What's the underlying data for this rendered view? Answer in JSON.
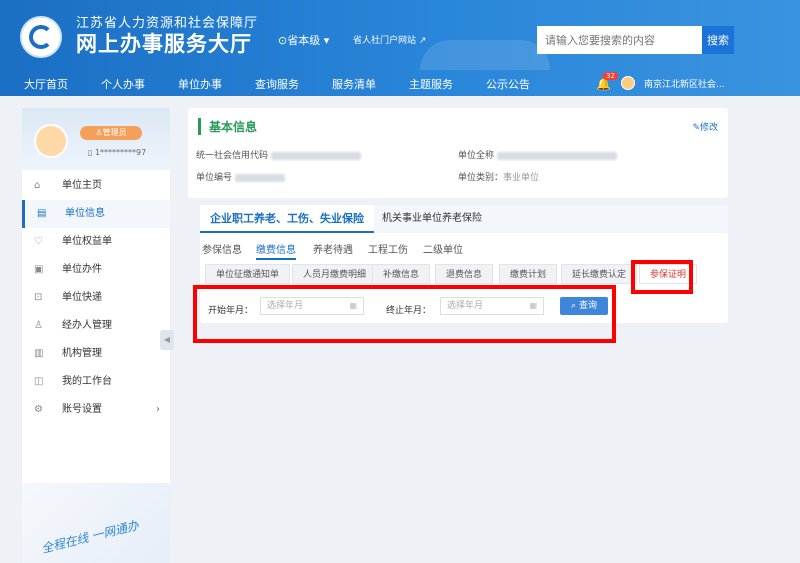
{
  "header": {
    "org": "江苏省人力资源和社会保障厅",
    "site": "网上办事服务大厅",
    "level": "省本级",
    "portal": "省人社门户网站",
    "search_placeholder": "请输入您要搜索的内容",
    "search_btn": "搜索"
  },
  "nav": {
    "items": [
      "大厅首页",
      "个人办事",
      "单位办事",
      "查询服务",
      "服务清单",
      "主题服务",
      "公示公告"
    ],
    "badge": "32",
    "user": "南京江北新区社会..."
  },
  "sidebar": {
    "role": "管理员",
    "phone": "1*********97",
    "items": [
      {
        "label": "单位主页",
        "icon": "home-icon"
      },
      {
        "label": "单位信息",
        "icon": "document-icon"
      },
      {
        "label": "单位权益单",
        "icon": "heart-icon"
      },
      {
        "label": "单位办件",
        "icon": "file-icon"
      },
      {
        "label": "单位快递",
        "icon": "truck-icon"
      },
      {
        "label": "经办人管理",
        "icon": "user-icon"
      },
      {
        "label": "机构管理",
        "icon": "building-icon"
      },
      {
        "label": "我的工作台",
        "icon": "chart-icon"
      },
      {
        "label": "账号设置",
        "icon": "settings-icon"
      }
    ],
    "active_index": 1
  },
  "basic": {
    "title": "基本信息",
    "edit": "修改",
    "credit_code_label": "统一社会信用代码",
    "unit_name_label": "单位全称",
    "unit_no_label": "单位编号",
    "unit_type_label": "单位类别：",
    "unit_type_value": "事业单位"
  },
  "tabs": {
    "main": [
      "企业职工养老、工伤、失业保险",
      "机关事业单位养老保险"
    ],
    "sub": [
      "参保信息",
      "缴费信息",
      "养老待遇",
      "工程工伤",
      "二级单位"
    ],
    "pills": [
      "单位征缴通知单",
      "人员月缴费明细",
      "补缴信息",
      "退费信息",
      "缴费计划",
      "延长缴费认定",
      "参保证明"
    ]
  },
  "filter": {
    "start_label": "开始年月：",
    "start_placeholder": "选择年月",
    "end_label": "终止年月：",
    "end_placeholder": "选择年月",
    "query": "查询"
  }
}
